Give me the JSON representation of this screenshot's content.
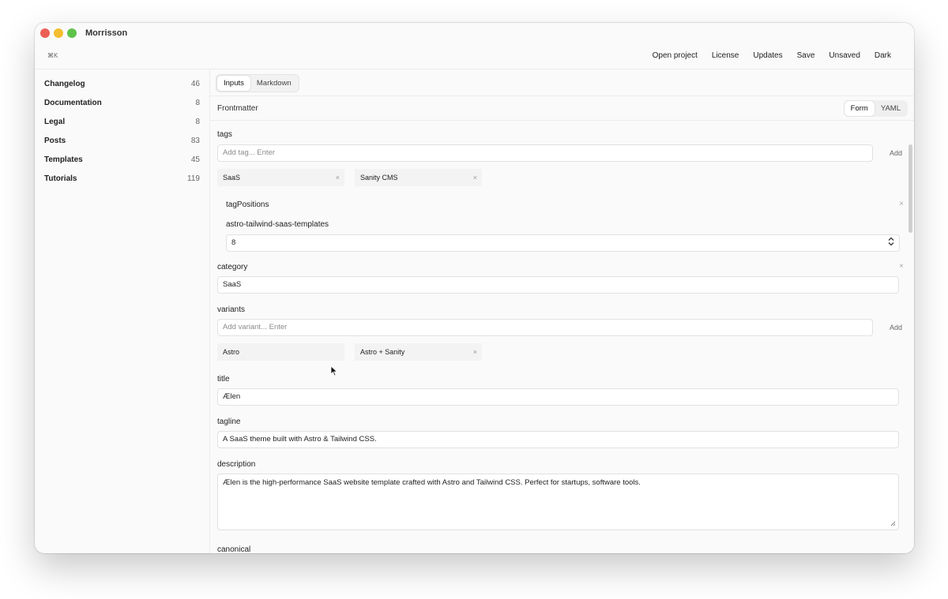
{
  "window": {
    "title": "Morrisson"
  },
  "toolbar": {
    "shortcut": "⌘K",
    "actions": [
      "Open project",
      "License",
      "Updates",
      "Save",
      "Unsaved",
      "Dark"
    ]
  },
  "sidebar": {
    "items": [
      {
        "label": "Changelog",
        "count": "46"
      },
      {
        "label": "Documentation",
        "count": "8"
      },
      {
        "label": "Legal",
        "count": "8"
      },
      {
        "label": "Posts",
        "count": "83"
      },
      {
        "label": "Templates",
        "count": "45"
      },
      {
        "label": "Tutorials",
        "count": "119"
      }
    ]
  },
  "main": {
    "tabs": [
      "Inputs",
      "Markdown"
    ],
    "frontmatter": {
      "title": "Frontmatter",
      "modes": [
        "Form",
        "YAML"
      ]
    }
  },
  "form": {
    "tags": {
      "label": "tags",
      "placeholder": "Add tag... Enter",
      "add_label": "Add",
      "chips": [
        "SaaS",
        "Sanity CMS"
      ],
      "remove_glyph": "×"
    },
    "tagPositions": {
      "label": "tagPositions",
      "key": "astro-tailwind-saas-templates",
      "value": "8"
    },
    "category": {
      "label": "category",
      "value": "SaaS"
    },
    "variants": {
      "label": "variants",
      "placeholder": "Add variant... Enter",
      "add_label": "Add",
      "chips": [
        "Astro",
        "Astro + Sanity"
      ]
    },
    "title": {
      "label": "title",
      "value": "Ælen"
    },
    "tagline": {
      "label": "tagline",
      "value": "A SaaS theme built with Astro & Tailwind CSS."
    },
    "description": {
      "label": "description",
      "value": "Ælen is the high-performance SaaS website template crafted with Astro and Tailwind CSS. Perfect for startups, software tools."
    },
    "canonical": {
      "label": "canonical"
    }
  },
  "icons": {
    "close": "close-icon",
    "stepper": "updown-stepper-icon",
    "resize": "resize-handle-icon",
    "pointer": "mouse-pointer-icon"
  }
}
